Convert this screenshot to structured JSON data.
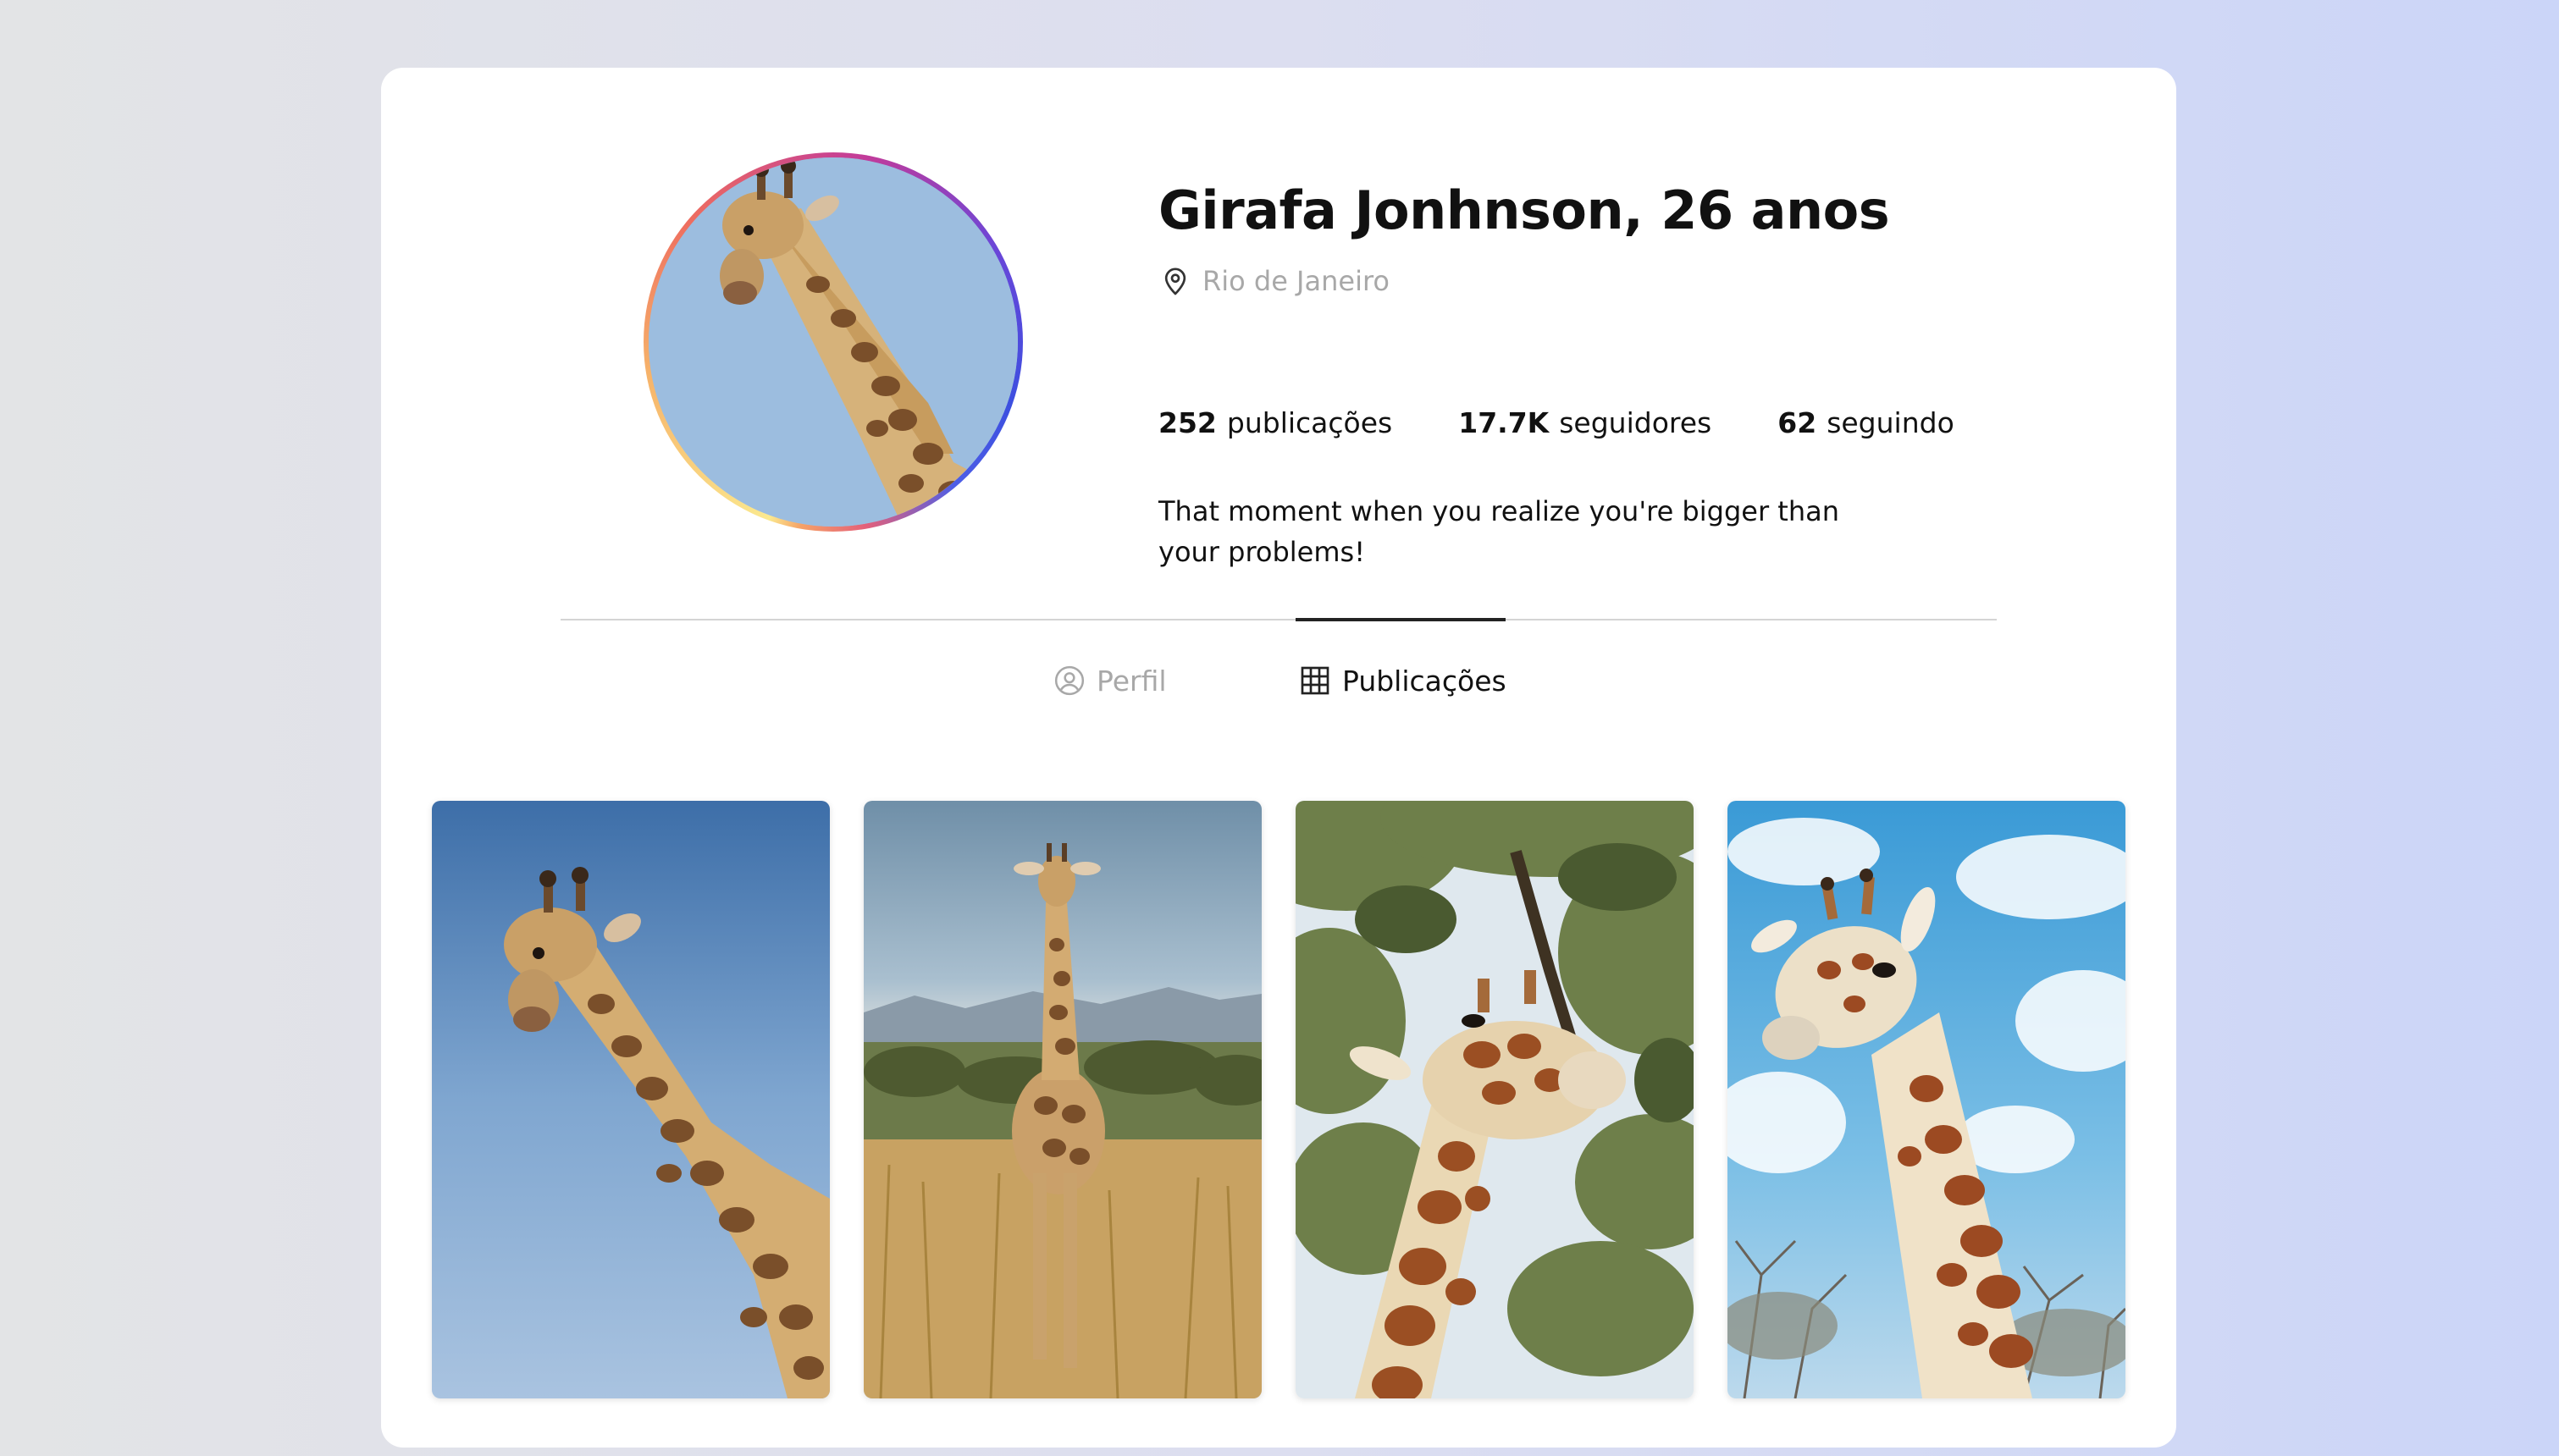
{
  "profile": {
    "name": "Girafa Jonhnson, 26 anos",
    "location": "Rio de Janeiro",
    "stats": [
      {
        "value": "252",
        "label": "publicações"
      },
      {
        "value": "17.7K",
        "label": "seguidores"
      },
      {
        "value": "62",
        "label": "seguindo"
      }
    ],
    "bio": "That moment when you realize you're bigger than your problems!"
  },
  "tabs": [
    {
      "label": "Perfil",
      "icon": "user-circle-icon",
      "active": false
    },
    {
      "label": "Publicações",
      "icon": "grid-icon",
      "active": true
    }
  ],
  "photos": [
    {
      "subject": "giraffe-head-blue-sky"
    },
    {
      "subject": "giraffe-standing-savanna"
    },
    {
      "subject": "giraffe-under-tree"
    },
    {
      "subject": "giraffe-clouds"
    }
  ],
  "colors": {
    "active_tab": "#111111",
    "inactive_tab": "#a8a8a8",
    "avatar_ring_start": "#fbe98f",
    "avatar_ring_end": "#3c4fe0"
  }
}
